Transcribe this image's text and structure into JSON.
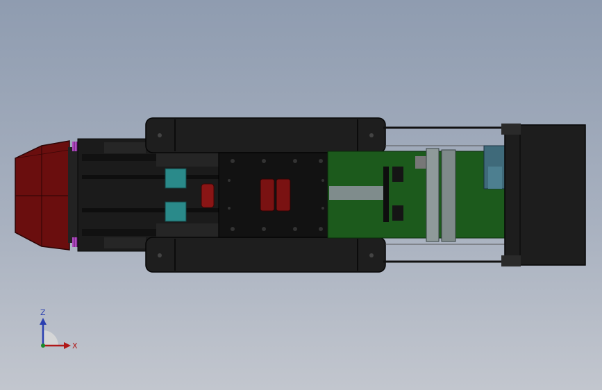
{
  "viewport": {
    "background_top": "#8f9cb0",
    "background_bottom": "#c2c6ce"
  },
  "triad": {
    "z_label": "Z",
    "x_label": "X",
    "z_color": "#2a3fb0",
    "x_color": "#b01818",
    "y_color": "#1a8a2a"
  },
  "model": {
    "body_color": "#1b1b1b",
    "plate_color": "#121212",
    "wedge_color": "#6a0e0e",
    "pcb_color": "#1c5a1c",
    "teal_color": "#2a8a8a",
    "spring_color": "#b04ac0",
    "rail_color": "#8f9a9a",
    "motor_color": "#3f6a7a",
    "icons": [
      "cad-assembly-icon",
      "triad-icon"
    ]
  }
}
